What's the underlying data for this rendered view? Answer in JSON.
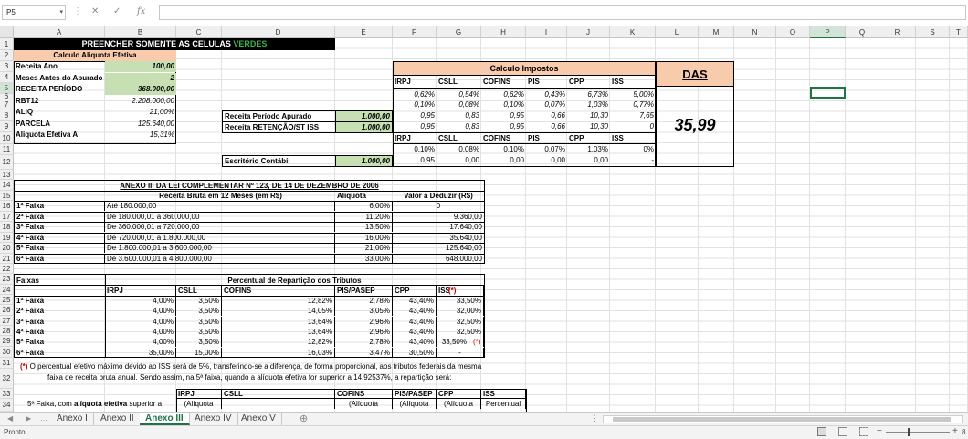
{
  "formula_bar": {
    "name_box": "P5",
    "fx_label": "fx",
    "formula": ""
  },
  "columns": [
    {
      "label": "A"
    },
    {
      "label": "B"
    },
    {
      "label": "C"
    },
    {
      "label": "D"
    },
    {
      "label": "E"
    },
    {
      "label": "F"
    },
    {
      "label": "G"
    },
    {
      "label": "H"
    },
    {
      "label": "I"
    },
    {
      "label": "J"
    },
    {
      "label": "K"
    },
    {
      "label": "L"
    },
    {
      "label": "M"
    },
    {
      "label": "N"
    },
    {
      "label": "O"
    },
    {
      "label": "P"
    },
    {
      "label": "Q"
    },
    {
      "label": "R"
    },
    {
      "label": "S"
    },
    {
      "label": "T"
    }
  ],
  "rows": [
    "1",
    "2",
    "3",
    "4",
    "5",
    "6",
    "7",
    "8",
    "9",
    "10",
    "11",
    "12",
    "13",
    "14",
    "15",
    "16",
    "17",
    "18",
    "19",
    "20",
    "21",
    "22",
    "23",
    "24",
    "25",
    "26",
    "27",
    "28",
    "29",
    "30",
    "31",
    "32",
    "33",
    "34"
  ],
  "banner": {
    "text": "PREENCHER SOMENTE AS CELULAS ",
    "green": "VERDES"
  },
  "aliquota": {
    "title": "Calculo Aliquota Efetiva",
    "items": [
      {
        "label": "Receita Ano",
        "value": "100,00"
      },
      {
        "label": "Meses Antes do Apurado",
        "value": "2"
      },
      {
        "label": "RECEITA PERÍODO",
        "value": "368.000,00"
      },
      {
        "label": "RBT12",
        "value": "2.208.000,00"
      },
      {
        "label": "ALIQ",
        "value": "21,00%"
      },
      {
        "label": "PARCELA",
        "value": "125.640,00"
      },
      {
        "label": "Aliquota Efetiva A",
        "value": "15,31%"
      }
    ]
  },
  "inputs": {
    "receita_periodo_label": "Receita Período Apurado",
    "receita_periodo_value": "1.000,00",
    "retencao_label": "Receita RETENÇÃO/ST ISS",
    "retencao_value": "1.000,00",
    "escritorio_label": "Escritório Contábil",
    "escritorio_value": "1.000,00"
  },
  "impostos": {
    "title": "Calculo Impostos",
    "headers": [
      "IRPJ",
      "CSLL",
      "COFINS",
      "PIS",
      "CPP",
      "ISS"
    ],
    "row_a": [
      "0,62%",
      "0,54%",
      "0,62%",
      "0,43%",
      "6,73%",
      "5,00%"
    ],
    "row_b": [
      "0,10%",
      "0,08%",
      "0,10%",
      "0,07%",
      "1,03%",
      "0,77%"
    ],
    "row_c": [
      "0,95",
      "0,83",
      "0,95",
      "0,66",
      "10,30",
      "7,65"
    ],
    "row_d": [
      "0,95",
      "0,83",
      "0,95",
      "0,66",
      "10,30",
      "0"
    ],
    "headers2": [
      "IRPJ",
      "CSLL",
      "COFINS",
      "PIS",
      "CPP",
      "ISS"
    ],
    "row_e": [
      "0,10%",
      "0,08%",
      "0,10%",
      "0,07%",
      "1,03%",
      "0%"
    ],
    "row_f": [
      "0,95",
      "0,00",
      "0,00",
      "0,00",
      "0,00",
      "-"
    ]
  },
  "das": {
    "label": "DAS",
    "value": "35,99"
  },
  "anexo": {
    "title": "ANEXO III DA LEI COMPLEMENTAR Nº 123, DE 14 DE DEZEMBRO DE 2006",
    "col_receita": "Receita Bruta em 12 Meses (em R$)",
    "col_aliquota": "Alíquota",
    "col_deduzir": "Valor a Deduzir (R$)",
    "faixas": [
      {
        "faixa": "1ª Faixa",
        "receita": "Até 180.000,00",
        "aliquota": "6,00%",
        "deduzir": "0"
      },
      {
        "faixa": "2ª Faixa",
        "receita": "De 180.000,01 a 360.000,00",
        "aliquota": "11,20%",
        "deduzir": "9.360,00"
      },
      {
        "faixa": "3ª Faixa",
        "receita": "De 360.000,01 a 720.000,00",
        "aliquota": "13,50%",
        "deduzir": "17.640,00"
      },
      {
        "faixa": "4ª Faixa",
        "receita": "De 720.000,01 a 1.800.000,00",
        "aliquota": "16,00%",
        "deduzir": "35.640,00"
      },
      {
        "faixa": "5ª Faixa",
        "receita": "De 1.800.000,01 a 3.600.000,00",
        "aliquota": "21,00%",
        "deduzir": "125.640,00"
      },
      {
        "faixa": "6ª Faixa",
        "receita": "De 3.600.000,01 a 4.800.000,00",
        "aliquota": "33,00%",
        "deduzir": "648.000,00"
      }
    ]
  },
  "reparticao": {
    "faixas_label": "Faixas",
    "title": "Percentual de Repartição dos Tributos",
    "headers": [
      "IRPJ",
      "CSLL",
      "COFINS",
      "PIS/PASEP",
      "CPP",
      "ISS"
    ],
    "star": "(*)",
    "rows": [
      {
        "faixa": "1ª Faixa",
        "v": [
          "4,00%",
          "3,50%",
          "12,82%",
          "2,78%",
          "43,40%",
          "33,50%"
        ]
      },
      {
        "faixa": "2ª Faixa",
        "v": [
          "4,00%",
          "3,50%",
          "14,05%",
          "3,05%",
          "43,40%",
          "32,00%"
        ]
      },
      {
        "faixa": "3ª Faixa",
        "v": [
          "4,00%",
          "3,50%",
          "13,64%",
          "2,96%",
          "43,40%",
          "32,50%"
        ]
      },
      {
        "faixa": "4ª Faixa",
        "v": [
          "4,00%",
          "3,50%",
          "13,64%",
          "2,96%",
          "43,40%",
          "32,50%"
        ]
      },
      {
        "faixa": "5ª Faixa",
        "v": [
          "4,00%",
          "3,50%",
          "12,82%",
          "2,78%",
          "43,40%",
          "33,50%"
        ],
        "star": "(*)"
      },
      {
        "faixa": "6ª Faixa",
        "v": [
          "35,00%",
          "15,00%",
          "16,03%",
          "3,47%",
          "30,50%",
          "-"
        ]
      }
    ]
  },
  "nota": {
    "star": "(*)",
    "line1": " O percentual efetivo máximo devido ao ISS será de 5%, transferindo-se a diferença, de forma proporcional, aos tributos federais da mesma",
    "line2": "faixa de receita bruta anual. Sendo assim, na 5ª faixa, quando a alíquota efetiva for superior a 14,92537%, a repartição será:"
  },
  "bottom": {
    "headers": [
      "IRPJ",
      "CSLL",
      "COFINS",
      "PIS/PASEP",
      "CPP",
      "ISS"
    ],
    "faixa_prefix": "5ª Faixa, com ",
    "faixa_bold": "alíquota efetiva",
    "faixa_suffix": " superior a",
    "row34": [
      "(Alíquota",
      "",
      "(Alíquota",
      "(Alíquota",
      "(Alíquota",
      "Percentual"
    ]
  },
  "tabs": [
    {
      "label": "Anexo I"
    },
    {
      "label": "Anexo II"
    },
    {
      "label": "Anexo III"
    },
    {
      "label": "Anexo IV"
    },
    {
      "label": "Anexo V"
    }
  ],
  "active_tab": "Anexo III",
  "add_sheet": "⊕",
  "status": {
    "mode": "Pronto",
    "zoom": "8"
  },
  "colors": {
    "green_fill": "#c6e0b4",
    "orange_fill": "#f8cbad",
    "banner_black": "#000000",
    "banner_green": "#39b54a",
    "excel_green": "#217346"
  }
}
